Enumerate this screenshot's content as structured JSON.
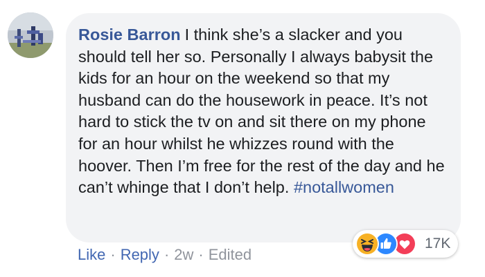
{
  "comment": {
    "author": "Rosie Barron",
    "text": "I think she’s a slacker and you should tell her so. Personally I always babysit the kids for an hour on the weekend so that my husband can do the housework in peace. It’s not hard to stick the tv on and sit there on my phone for an hour whilst he whizzes round with the hoover. Then I’m free for the rest of the day and he can’t whinge that I don’t help.",
    "hashtag": "#notallwomen"
  },
  "actions": {
    "like": "Like",
    "reply": "Reply",
    "separator": "·",
    "time": "2w",
    "edited": "Edited"
  },
  "reactions": {
    "icons": [
      "haha-icon",
      "like-icon",
      "love-icon"
    ],
    "count": "17K"
  },
  "colors": {
    "author_link": "#385898",
    "action_link": "#4267b2",
    "bubble_bg": "#f2f3f5",
    "meta_text": "#90949c"
  }
}
